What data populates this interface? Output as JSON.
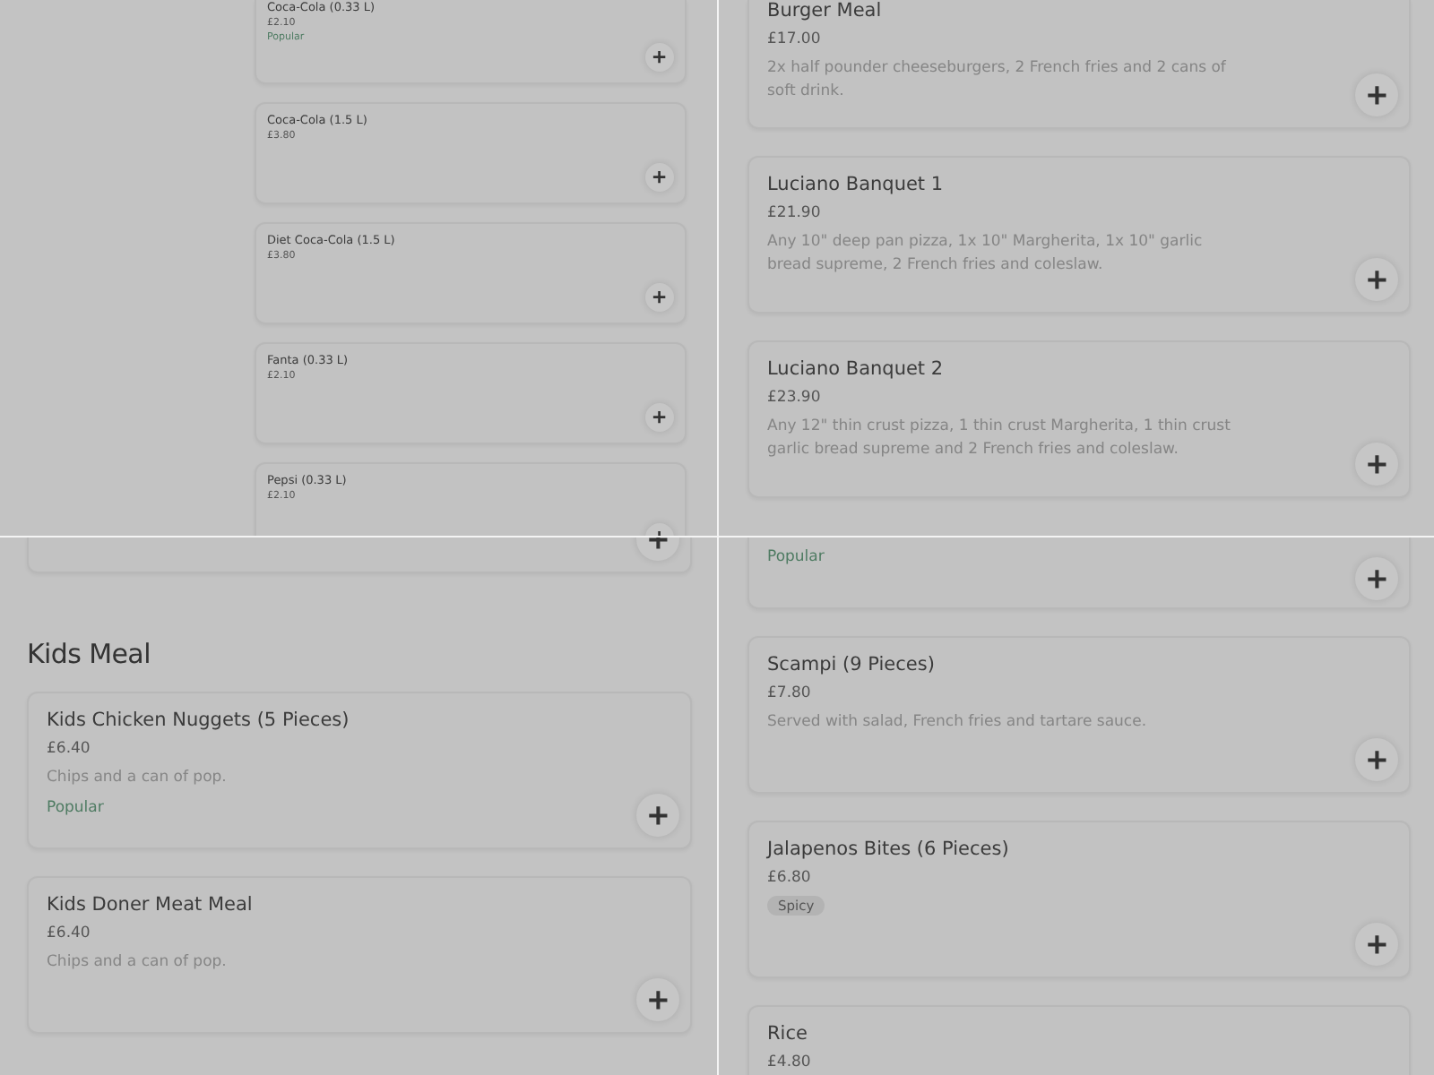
{
  "panels": [
    {
      "cards": [
        {
          "cut": true,
          "name": "Coca-Cola (0.33 L)",
          "price": "£2.10",
          "tag": {
            "kind": "popular",
            "label": "Popular"
          }
        },
        {
          "name": "Coca-Cola (1.5 L)",
          "price": "£3.80"
        },
        {
          "name": "Diet Coca-Cola (1.5 L)",
          "price": "£3.80"
        },
        {
          "name": "Fanta (0.33 L)",
          "price": "£2.10"
        },
        {
          "name": "Pepsi (0.33 L)",
          "price": "£2.10"
        }
      ]
    },
    {
      "cards": [
        {
          "cut": true,
          "name": "Burger Meal",
          "price": "£17.00",
          "description": "2x half pounder cheeseburgers, 2 French fries and 2 cans of soft drink."
        },
        {
          "name": "Luciano Banquet 1",
          "price": "£21.90",
          "description": "Any 10\" deep pan pizza, 1x 10\" Margherita, 1x 10\" garlic bread supreme, 2 French fries and coleslaw."
        },
        {
          "name": "Luciano Banquet 2",
          "price": "£23.90",
          "description": "Any 12\" thin crust pizza, 1 thin crust Margherita, 1 thin crust garlic bread supreme and 2 French fries and coleslaw."
        }
      ]
    },
    {
      "cards": [
        {
          "cut": true
        },
        {
          "heading": "Kids Meal",
          "name": "Kids Chicken Nuggets (5 Pieces)",
          "price": "£6.40",
          "description": "Chips and a can of pop.",
          "tag": {
            "kind": "popular",
            "label": "Popular"
          }
        },
        {
          "name": "Kids Doner Meat Meal",
          "price": "£6.40",
          "description": "Chips and a can of pop."
        }
      ]
    },
    {
      "cards": [
        {
          "cut": true,
          "tag": {
            "kind": "popular",
            "label": "Popular"
          }
        },
        {
          "name": "Scampi (9 Pieces)",
          "price": "£7.80",
          "description": "Served with salad, French fries and tartare sauce."
        },
        {
          "name": "Jalapenos Bites (6 Pieces)",
          "price": "£6.80",
          "tag": {
            "kind": "spicy",
            "label": "Spicy"
          }
        },
        {
          "name": "Rice",
          "price": "£4.80"
        }
      ]
    }
  ]
}
